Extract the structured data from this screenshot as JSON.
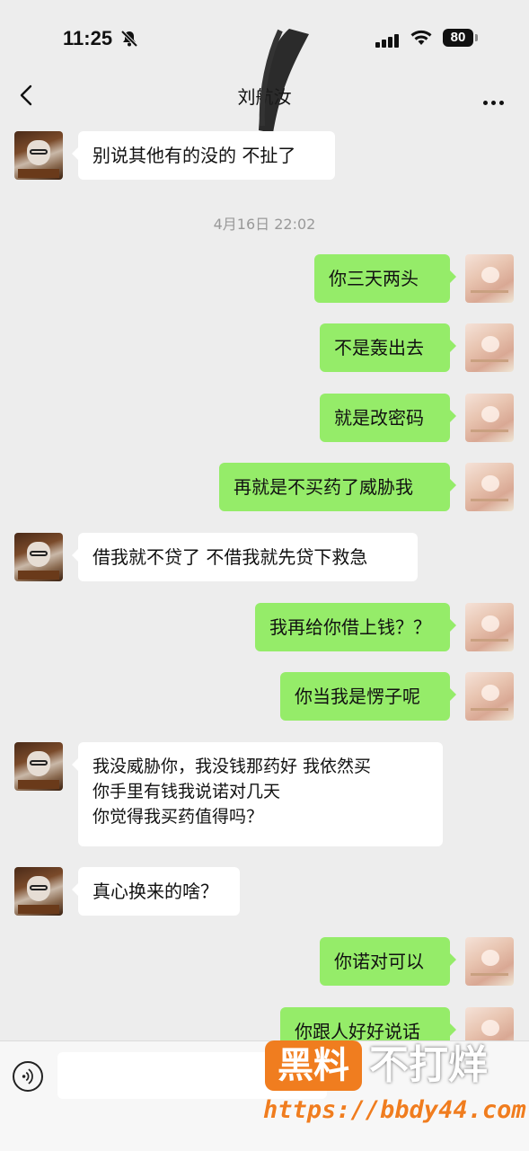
{
  "status_bar": {
    "time": "11:25",
    "battery": "80"
  },
  "header": {
    "title": "刘航汝"
  },
  "messages": [
    {
      "text": "别说其他有的没的 不扯了"
    },
    {
      "text": "你三天两头"
    },
    {
      "text": "不是轰出去"
    },
    {
      "text": "就是改密码"
    },
    {
      "text": "再就是不买药了威胁我"
    },
    {
      "text": "借我就不贷了 不借我就先贷下救急"
    },
    {
      "text": "我再给你借上钱？？"
    },
    {
      "text": "你当我是愣子呢"
    },
    {
      "text": "我没威胁你，我没钱那药好 我依然买\n你手里有钱我说诺对几天\n你觉得我买药值得吗？"
    },
    {
      "text": "真心换来的啥？"
    },
    {
      "text": "你诺对可以"
    },
    {
      "text": "你跟人好好说话"
    }
  ],
  "timestamp": "4月16日 22:02",
  "watermark": {
    "badge": "黑料",
    "text": "不打烊",
    "url": "https://bbdy44.com"
  },
  "colors": {
    "outgoing_bubble": "#95ec69",
    "incoming_bubble": "#ffffff",
    "background": "#ededed"
  }
}
